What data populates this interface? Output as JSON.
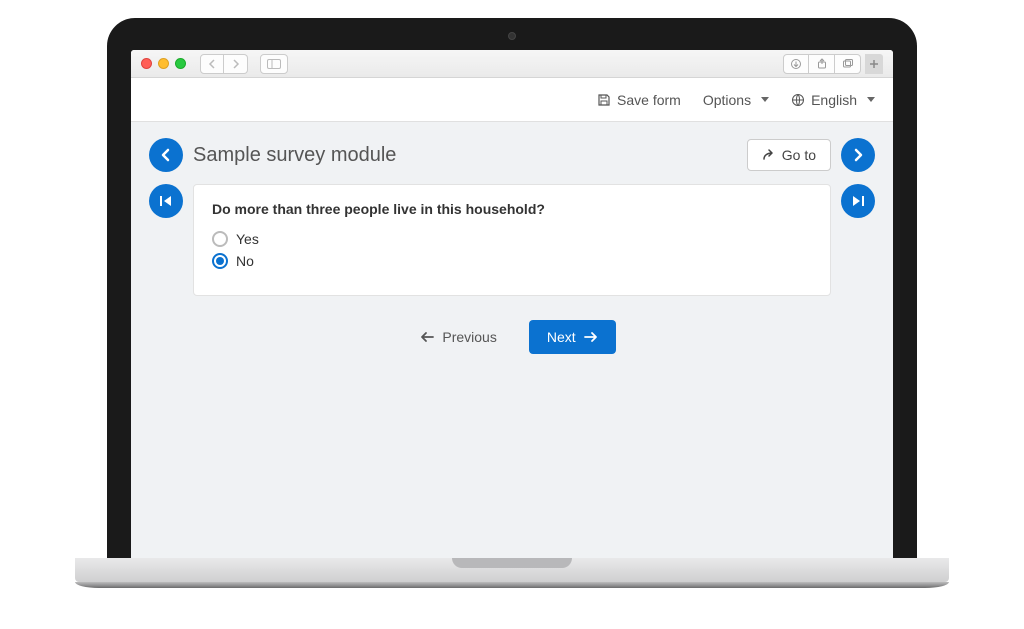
{
  "toolbar": {
    "save_label": "Save form",
    "options_label": "Options",
    "language_label": "English"
  },
  "header": {
    "title": "Sample survey module",
    "goto_label": "Go to"
  },
  "question": {
    "text": "Do more than three people live in this household?",
    "options": [
      {
        "label": "Yes",
        "selected": false
      },
      {
        "label": "No",
        "selected": true
      }
    ]
  },
  "footer": {
    "prev_label": "Previous",
    "next_label": "Next"
  }
}
